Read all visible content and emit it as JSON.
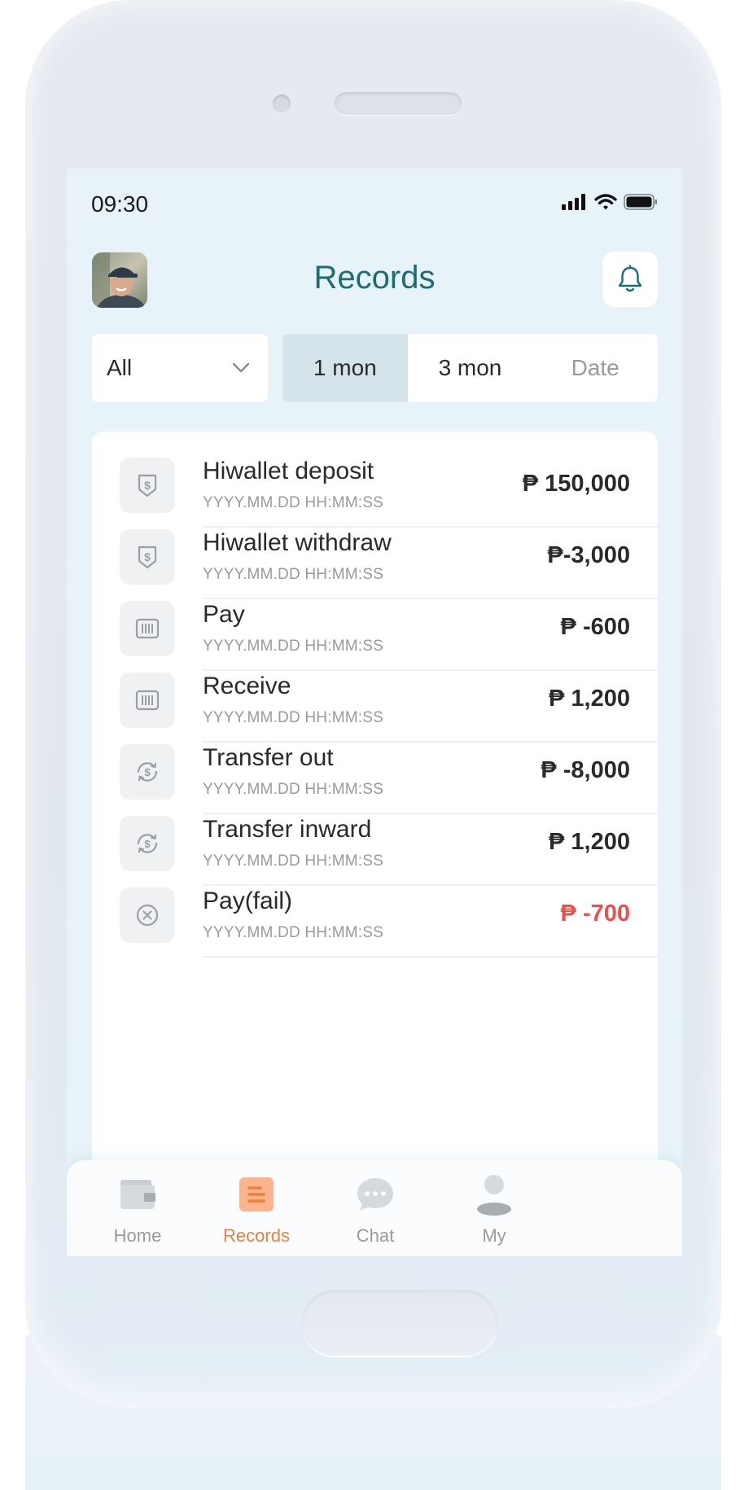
{
  "status_bar": {
    "time": "09:30"
  },
  "header": {
    "title": "Records"
  },
  "filters": {
    "category_selected": "All",
    "ranges": [
      {
        "label": "1 mon",
        "active": true
      },
      {
        "label": "3 mon",
        "active": false
      },
      {
        "label": "Date",
        "active": false
      }
    ]
  },
  "records": [
    {
      "title": "Hiwallet deposit",
      "datetime": "YYYY.MM.DD HH:MM:SS",
      "amount": "₱ 150,000",
      "icon": "wallet-shield-icon",
      "status": "success"
    },
    {
      "title": "Hiwallet withdraw",
      "datetime": "YYYY.MM.DD HH:MM:SS",
      "amount": "₱-3,000",
      "icon": "wallet-shield-icon",
      "status": "success"
    },
    {
      "title": "Pay",
      "datetime": "YYYY.MM.DD HH:MM:SS",
      "amount": "₱ -600",
      "icon": "barcode-icon",
      "status": "success"
    },
    {
      "title": "Receive",
      "datetime": "YYYY.MM.DD HH:MM:SS",
      "amount": "₱ 1,200",
      "icon": "barcode-icon",
      "status": "success"
    },
    {
      "title": "Transfer out",
      "datetime": "YYYY.MM.DD HH:MM:SS",
      "amount": "₱ -8,000",
      "icon": "transfer-icon",
      "status": "success"
    },
    {
      "title": "Transfer inward",
      "datetime": "YYYY.MM.DD HH:MM:SS",
      "amount": "₱ 1,200",
      "icon": "transfer-icon",
      "status": "success"
    },
    {
      "title": "Pay(fail)",
      "datetime": "YYYY.MM.DD HH:MM:SS",
      "amount": "₱ -700",
      "icon": "close-circle-icon",
      "status": "fail"
    }
  ],
  "tabbar": {
    "home": "Home",
    "records": "Records",
    "chat": "Chat",
    "my": "My",
    "active": "records"
  },
  "colors": {
    "accent": "#196d74",
    "active_tab": "#ef7e3c",
    "fail": "#ea4f4a",
    "screen_bg": "#e7f3f9"
  }
}
